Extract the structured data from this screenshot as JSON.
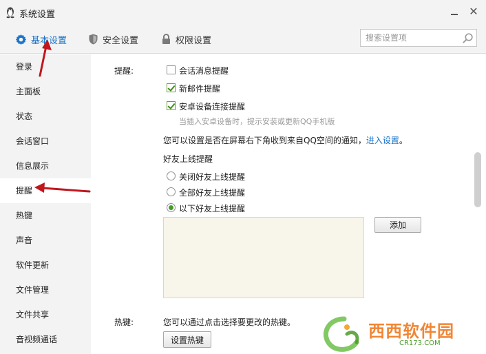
{
  "window": {
    "title": "系统设置"
  },
  "tabs": [
    {
      "label": "基本设置",
      "active": true
    },
    {
      "label": "安全设置",
      "active": false
    },
    {
      "label": "权限设置",
      "active": false
    }
  ],
  "search": {
    "placeholder": "搜索设置项"
  },
  "sidebar": {
    "items": [
      {
        "label": "登录"
      },
      {
        "label": "主面板"
      },
      {
        "label": "状态"
      },
      {
        "label": "会话窗口"
      },
      {
        "label": "信息展示"
      },
      {
        "label": "提醒",
        "active": true
      },
      {
        "label": "热键"
      },
      {
        "label": "声音"
      },
      {
        "label": "软件更新"
      },
      {
        "label": "文件管理"
      },
      {
        "label": "文件共享"
      },
      {
        "label": "音视频通话"
      }
    ]
  },
  "reminder": {
    "section_label": "提醒:",
    "options": [
      {
        "label": "会话消息提醒",
        "checked": false
      },
      {
        "label": "新邮件提醒",
        "checked": true
      },
      {
        "label": "安卓设备连接提醒",
        "checked": true
      }
    ],
    "android_hint": "当插入安卓设备时，提示安装或更新QQ手机版",
    "qzone_text": "您可以设置是否在屏幕右下角收到来自QQ空间的通知，",
    "qzone_link": "进入设置",
    "qzone_end": "。",
    "friends_title": "好友上线提醒",
    "friend_options": [
      {
        "label": "关闭好友上线提醒",
        "selected": false
      },
      {
        "label": "全部好友上线提醒",
        "selected": false
      },
      {
        "label": "以下好友上线提醒",
        "selected": true
      }
    ],
    "add_button": "添加"
  },
  "hotkey": {
    "section_label": "热键:",
    "text": "您可以通过点击选择要更改的热键。",
    "button": "设置热键"
  },
  "watermark": {
    "text": "西西软件园",
    "sub": "CR173.COM"
  },
  "colors": {
    "accent": "#1a74c9",
    "arrow": "#c0161c",
    "check": "#3f8a18",
    "friend_box": "#f8f5ea"
  }
}
